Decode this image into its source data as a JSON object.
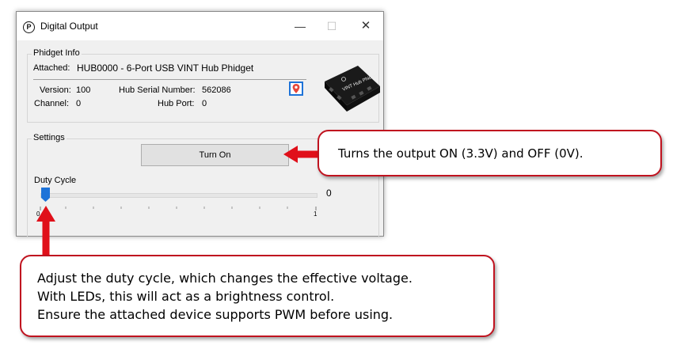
{
  "window": {
    "title": "Digital Output",
    "app_icon_glyph": "P",
    "controls": {
      "minimize": "—",
      "maximize": "☐",
      "close": "✕"
    }
  },
  "phidget_info": {
    "group_label": "Phidget Info",
    "attached_label": "Attached:",
    "attached_value": "HUB0000 - 6-Port USB VINT Hub Phidget",
    "version_label": "Version:",
    "version_value": "100",
    "hub_serial_label": "Hub Serial Number:",
    "hub_serial_value": "562086",
    "channel_label": "Channel:",
    "channel_value": "0",
    "hub_port_label": "Hub Port:",
    "hub_port_value": "0",
    "locate_icon": "map-pin-icon",
    "device_image_text": "VINT Hub Phidget"
  },
  "settings": {
    "group_label": "Settings",
    "turn_on_label": "Turn On",
    "duty_cycle_label": "Duty Cycle",
    "duty_cycle_value": "0",
    "duty_cycle_level": 0,
    "tick_min": "0",
    "tick_max": "1"
  },
  "callouts": {
    "turn_on": "Turns the output ON (3.3V) and OFF (0V).",
    "duty_cycle_line1": "Adjust the duty cycle, which changes the effective voltage.",
    "duty_cycle_line2": "With LEDs, this will act as a brightness control.",
    "duty_cycle_line3": "Ensure the attached device supports PWM before using."
  },
  "colors": {
    "callout_border": "#c0131f",
    "arrow": "#e0101a",
    "slider_thumb": "#1e73d8",
    "locate_border": "#1e73d8",
    "pin": "#e5473a"
  }
}
